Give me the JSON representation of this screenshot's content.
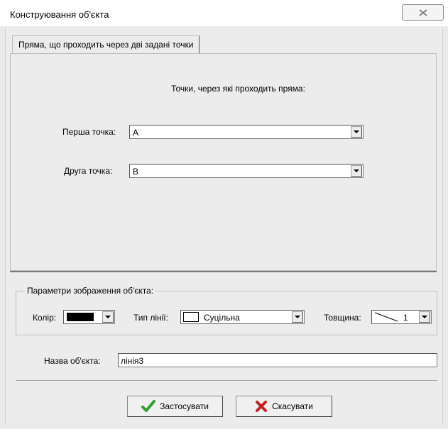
{
  "window": {
    "title": "Конструювання об'єкта",
    "close_icon": "close-icon"
  },
  "tab": {
    "label": "Пряма, що проходить через дві задані точки"
  },
  "points": {
    "heading": "Точки, через які проходить пряма:",
    "first_label": "Перша точка:",
    "first_value": "A",
    "second_label": "Друга точка:",
    "second_value": "B"
  },
  "display_params": {
    "legend": "Параметри зображення об'єкта:",
    "color_label": "Колір:",
    "color_value": "#000000",
    "line_type_label": "Тип лінії:",
    "line_type_value": "Суцільна",
    "thickness_label": "Товщина:",
    "thickness_value": "1"
  },
  "name": {
    "label": "Назва об'єкта:",
    "value": "лінія3"
  },
  "buttons": {
    "apply_label": "Застосувати",
    "apply_icon": "checkmark-icon",
    "cancel_label": "Скасувати",
    "cancel_icon": "cross-icon"
  },
  "colors": {
    "apply_icon": "#2e9e2e",
    "cancel_icon": "#c81e1e"
  }
}
